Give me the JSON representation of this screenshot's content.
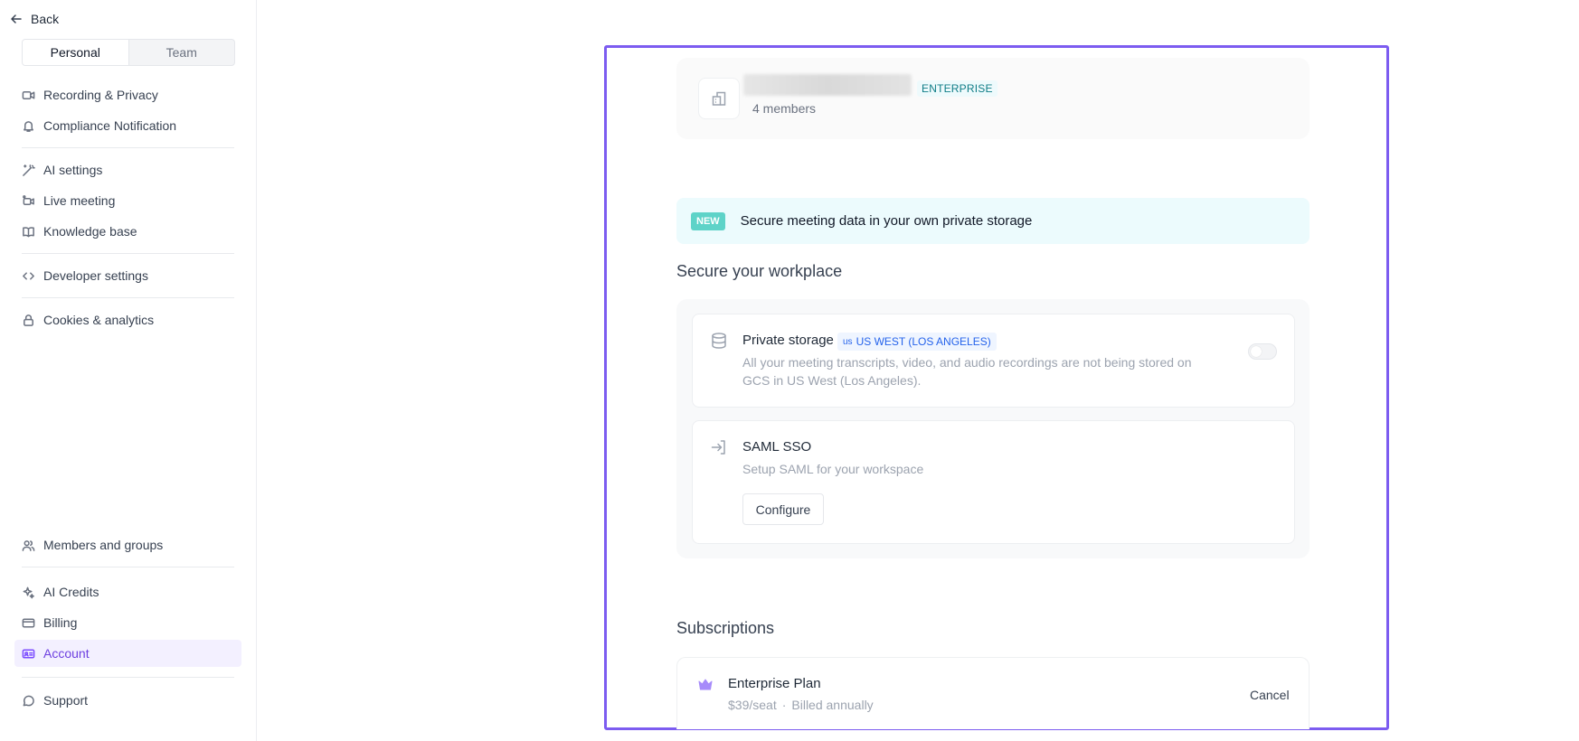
{
  "sidebar": {
    "back_label": "Back",
    "segments": [
      "Personal",
      "Team"
    ],
    "items": [
      {
        "label": "Recording & Privacy",
        "icon": "video-camera-icon"
      },
      {
        "label": "Compliance Notification",
        "icon": "bell-icon"
      },
      {
        "label": "AI settings",
        "icon": "magic-wand-icon"
      },
      {
        "label": "Live meeting",
        "icon": "live-video-icon"
      },
      {
        "label": "Knowledge base",
        "icon": "book-icon"
      },
      {
        "label": "Developer settings",
        "icon": "code-icon"
      },
      {
        "label": "Cookies & analytics",
        "icon": "lock-icon"
      },
      {
        "label": "Members and groups",
        "icon": "users-icon"
      },
      {
        "label": "AI Credits",
        "icon": "sparkle-icon"
      },
      {
        "label": "Billing",
        "icon": "credit-card-icon"
      },
      {
        "label": "Account",
        "icon": "id-card-icon"
      },
      {
        "label": "Support",
        "icon": "chat-bubble-icon"
      }
    ]
  },
  "org": {
    "badge": "ENTERPRISE",
    "members": "4 members"
  },
  "banner": {
    "badge": "NEW",
    "text": "Secure meeting data in your own private storage"
  },
  "secure": {
    "heading": "Secure your workplace",
    "private_storage": {
      "title": "Private storage",
      "region_code": "us",
      "region": "US WEST (LOS ANGELES)",
      "description_line1": "All your meeting transcripts, video, and audio recordings are not being stored on",
      "description_line2": "GCS in US West (Los Angeles).",
      "enabled": false
    },
    "saml": {
      "title": "SAML SSO",
      "description": "Setup SAML for your workspace",
      "button": "Configure"
    }
  },
  "subscriptions": {
    "heading": "Subscriptions",
    "plan": {
      "name": "Enterprise Plan",
      "price": "$39/seat",
      "separator": "·",
      "billing": "Billed annually",
      "cancel": "Cancel"
    }
  },
  "colors": {
    "accent": "#7c5cf0",
    "active_bg": "#f3f0ff",
    "banner_bg": "#ecfbfd",
    "new_badge": "#5ed3c8"
  }
}
